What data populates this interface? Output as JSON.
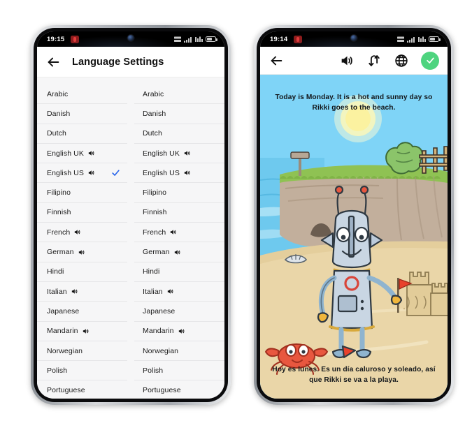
{
  "left_phone": {
    "status_bar": {
      "time": "19:15",
      "icons": [
        "mic-recording-icon",
        "vpn-icon",
        "signal-bars-icon",
        "wifi-icon",
        "battery-icon"
      ]
    },
    "header": {
      "back_label": "back-arrow-icon",
      "title": "Language Settings"
    },
    "columns": [
      {
        "name": "source-language-column",
        "rows": [
          {
            "label": "Arabic",
            "speaker": false,
            "selected": false
          },
          {
            "label": "Danish",
            "speaker": false,
            "selected": false
          },
          {
            "label": "Dutch",
            "speaker": false,
            "selected": false
          },
          {
            "label": "English UK",
            "speaker": true,
            "selected": false
          },
          {
            "label": "English US",
            "speaker": true,
            "selected": true
          },
          {
            "label": "Filipino",
            "speaker": false,
            "selected": false
          },
          {
            "label": "Finnish",
            "speaker": false,
            "selected": false
          },
          {
            "label": "French",
            "speaker": true,
            "selected": false
          },
          {
            "label": "German",
            "speaker": true,
            "selected": false
          },
          {
            "label": "Hindi",
            "speaker": false,
            "selected": false
          },
          {
            "label": "Italian",
            "speaker": true,
            "selected": false
          },
          {
            "label": "Japanese",
            "speaker": false,
            "selected": false
          },
          {
            "label": "Mandarin",
            "speaker": true,
            "selected": false
          },
          {
            "label": "Norwegian",
            "speaker": false,
            "selected": false
          },
          {
            "label": "Polish",
            "speaker": false,
            "selected": false
          },
          {
            "label": "Portuguese",
            "speaker": false,
            "selected": false
          }
        ]
      },
      {
        "name": "target-language-column",
        "rows": [
          {
            "label": "Arabic",
            "speaker": false,
            "selected": false
          },
          {
            "label": "Danish",
            "speaker": false,
            "selected": false
          },
          {
            "label": "Dutch",
            "speaker": false,
            "selected": false
          },
          {
            "label": "English UK",
            "speaker": true,
            "selected": false
          },
          {
            "label": "English US",
            "speaker": true,
            "selected": false
          },
          {
            "label": "Filipino",
            "speaker": false,
            "selected": false
          },
          {
            "label": "Finnish",
            "speaker": false,
            "selected": false
          },
          {
            "label": "French",
            "speaker": true,
            "selected": false
          },
          {
            "label": "German",
            "speaker": true,
            "selected": false
          },
          {
            "label": "Hindi",
            "speaker": false,
            "selected": false
          },
          {
            "label": "Italian",
            "speaker": true,
            "selected": false
          },
          {
            "label": "Japanese",
            "speaker": false,
            "selected": false
          },
          {
            "label": "Mandarin",
            "speaker": true,
            "selected": false
          },
          {
            "label": "Norwegian",
            "speaker": false,
            "selected": false
          },
          {
            "label": "Polish",
            "speaker": false,
            "selected": false
          },
          {
            "label": "Portuguese",
            "speaker": false,
            "selected": false
          }
        ]
      }
    ],
    "colors": {
      "selected_check": "#2563eb",
      "list_background": "#f6f6f7",
      "divider": "#e6e6e8"
    }
  },
  "right_phone": {
    "status_bar": {
      "time": "19:14",
      "icons": [
        "mic-recording-icon",
        "vpn-icon",
        "signal-bars-icon",
        "wifi-icon",
        "battery-icon"
      ]
    },
    "toolbar": {
      "back_label": "back-arrow-icon",
      "speaker_label": "speaker-icon",
      "swap_label": "swap-languages-icon",
      "globe_label": "globe-icon",
      "confirm_label": "confirm-check-icon"
    },
    "story": {
      "top_caption": "Today is Monday. It is a hot and sunny day so Rikki goes to the beach.",
      "bottom_caption": "Hoy es lunes. Es un día caluroso y soleado, así que Rikki se va a la playa.",
      "illustration": {
        "name": "beach-robot-illustration",
        "elements": [
          "sun",
          "sky",
          "sea",
          "cliff",
          "grass",
          "tree",
          "fence",
          "lamp-post",
          "robot-rikki",
          "sandcastle",
          "red-flag",
          "crab",
          "sand",
          "seashell"
        ]
      }
    },
    "colors": {
      "sky": "#7fd4f7",
      "sea": "#69c9ec",
      "sand": "#ead6a8",
      "cliff": "#b9a694",
      "grass": "#8cc152",
      "robot_body": "#c5d3e2",
      "crab": "#e8573f",
      "sun": "#fbf2a8",
      "confirm_button": "#4ed47f"
    }
  }
}
